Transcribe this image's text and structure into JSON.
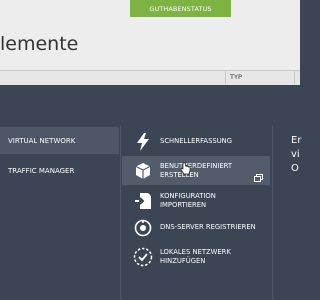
{
  "header": {
    "status_tab": "GUTHABENSTATUS",
    "page_title": "lemente",
    "col_typ": "TYP"
  },
  "left_menu": {
    "items": [
      {
        "label": "VIRTUAL NETWORK",
        "selected": true
      },
      {
        "label": "TRAFFIC MANAGER",
        "selected": false
      }
    ]
  },
  "submenu": {
    "items": [
      {
        "line1": "SCHNELLERFASSUNG",
        "line2": "",
        "icon": "lightning-icon"
      },
      {
        "line1": "BENUTZERDEFINIERT",
        "line2": "ERSTELLEN",
        "icon": "box-icon"
      },
      {
        "line1": "KONFIGURATION",
        "line2": "IMPORTIEREN",
        "icon": "import-icon"
      },
      {
        "line1": "DNS-SERVER REGISTRIEREN",
        "line2": "",
        "icon": "dns-icon"
      },
      {
        "line1": "LOKALES NETZWERK",
        "line2": "HINZUFÜGEN",
        "icon": "local-network-icon"
      }
    ]
  },
  "right_panel": {
    "line1": "Er",
    "line2": "vi",
    "line3": "O"
  },
  "colors": {
    "background": "#3b4554",
    "selected": "#4d5766",
    "hover": "#525c6b",
    "accent_green": "#7cb342",
    "top_bg": "#ededed"
  }
}
